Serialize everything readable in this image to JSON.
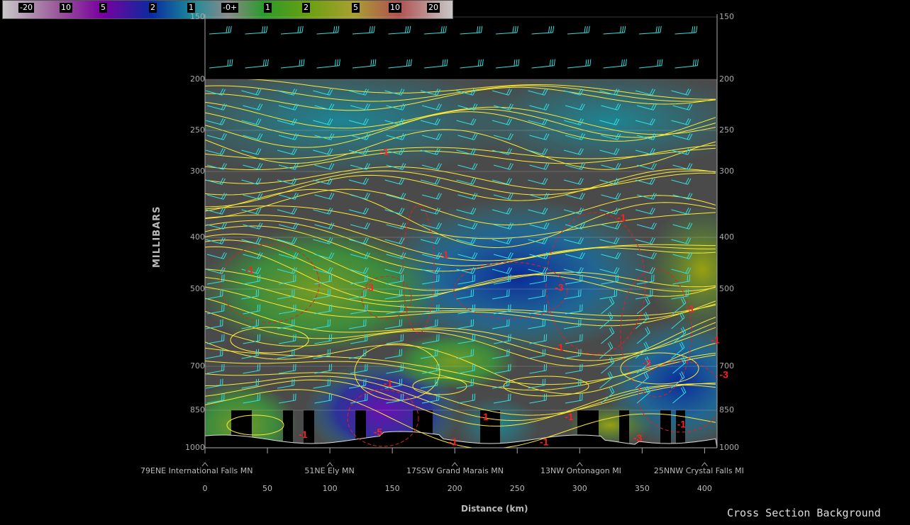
{
  "legend": {
    "ticks": [
      "-20",
      "10",
      "5",
      "2",
      "1",
      "-0+",
      "1",
      "2",
      "5",
      "10",
      "20"
    ]
  },
  "chart_data": {
    "type": "heatmap",
    "ylabel": "MILLIBARS",
    "xlabel": "Distance (km)",
    "y_ticks": [
      150,
      200,
      250,
      300,
      400,
      500,
      700,
      850,
      1000
    ],
    "x_ticks": [
      0,
      50,
      100,
      150,
      200,
      250,
      300,
      350,
      400
    ],
    "x_range": [
      0,
      410
    ],
    "y_range": [
      150,
      1000
    ],
    "stations": [
      {
        "label": "79ENE International Falls MN",
        "km": 0
      },
      {
        "label": "51NE Ely MN",
        "km": 100
      },
      {
        "label": "17SSW Grand Marais MN",
        "km": 200
      },
      {
        "label": "13NW Ontonagon MI",
        "km": 300
      },
      {
        "label": "25NNW Crystal Falls MI",
        "km": 400
      }
    ],
    "contour_labels": [
      {
        "text": "-1",
        "km": 32,
        "mb": 470
      },
      {
        "text": "-1",
        "km": 140,
        "mb": 280
      },
      {
        "text": "-3",
        "km": 128,
        "mb": 505
      },
      {
        "text": "-1",
        "km": 188,
        "mb": 440
      },
      {
        "text": "-1",
        "km": 330,
        "mb": 375
      },
      {
        "text": "-3",
        "km": 280,
        "mb": 505
      },
      {
        "text": "-1",
        "km": 280,
        "mb": 660
      },
      {
        "text": "-1",
        "km": 385,
        "mb": 560
      },
      {
        "text": "-1",
        "km": 405,
        "mb": 640
      },
      {
        "text": "-3",
        "km": 350,
        "mb": 700
      },
      {
        "text": "-3",
        "km": 412,
        "mb": 740
      },
      {
        "text": "-1",
        "km": 143,
        "mb": 770
      },
      {
        "text": "-1",
        "km": 220,
        "mb": 890
      },
      {
        "text": "-1",
        "km": 288,
        "mb": 890
      },
      {
        "text": "-1",
        "km": 378,
        "mb": 920
      },
      {
        "text": "-5",
        "km": 135,
        "mb": 950
      },
      {
        "text": "-1",
        "km": 75,
        "mb": 960
      },
      {
        "text": "-1",
        "km": 195,
        "mb": 990
      },
      {
        "text": "-1",
        "km": 268,
        "mb": 990
      },
      {
        "text": "-3",
        "km": 343,
        "mb": 975
      }
    ]
  },
  "background_title": "Cross Section Background"
}
